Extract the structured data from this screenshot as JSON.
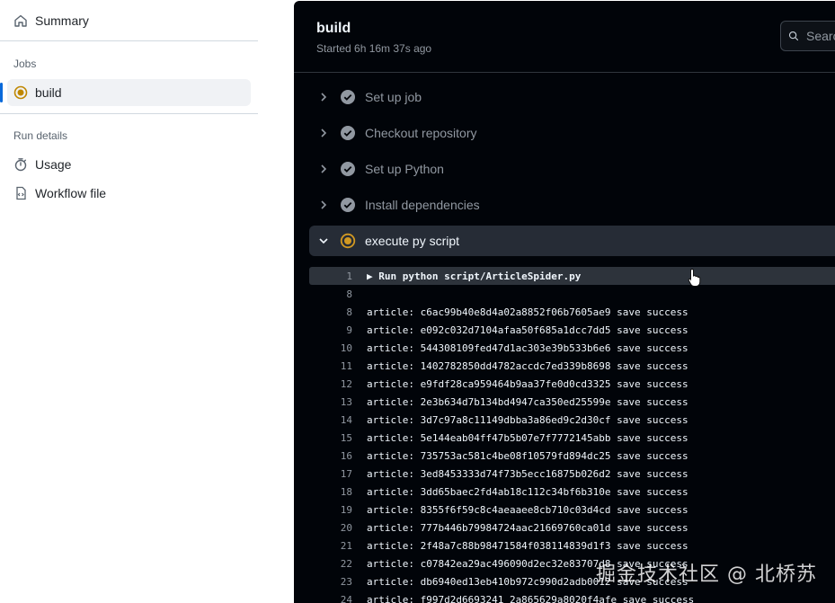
{
  "sidebar": {
    "summary_label": "Summary",
    "jobs_heading": "Jobs",
    "active_job": "build",
    "run_details_heading": "Run details",
    "usage_label": "Usage",
    "workflow_file_label": "Workflow file"
  },
  "job": {
    "title": "build",
    "started": "Started 6h 16m 37s ago"
  },
  "search": {
    "placeholder": "Search logs"
  },
  "steps": [
    {
      "label": "Set up job",
      "status": "success"
    },
    {
      "label": "Checkout repository",
      "status": "success"
    },
    {
      "label": "Set up Python",
      "status": "success"
    },
    {
      "label": "Install dependencies",
      "status": "success"
    },
    {
      "label": "execute py script",
      "status": "in-progress"
    }
  ],
  "log": [
    {
      "num": "1",
      "text": "▶ Run python script/ArticleSpider.py"
    },
    {
      "num": "8",
      "text": ""
    },
    {
      "num": "8",
      "text": "article: c6ac99b40e8d4a02a8852f06b7605ae9 save success"
    },
    {
      "num": "9",
      "text": "article: e092c032d7104afaa50f685a1dcc7dd5 save success"
    },
    {
      "num": "10",
      "text": "article: 544308109fed47d1ac303e39b533b6e6 save success"
    },
    {
      "num": "11",
      "text": "article: 1402782850dd4782accdc7ed339b8698 save success"
    },
    {
      "num": "12",
      "text": "article: e9fdf28ca959464b9aa37fe0d0cd3325 save success"
    },
    {
      "num": "13",
      "text": "article: 2e3b634d7b134bd4947ca350ed25599e save success"
    },
    {
      "num": "14",
      "text": "article: 3d7c97a8c11149dbba3a86ed9c2d30cf save success"
    },
    {
      "num": "15",
      "text": "article: 5e144eab04ff47b5b07e7f7772145abb save success"
    },
    {
      "num": "16",
      "text": "article: 735753ac581c4be08f10579fd894dc25 save success"
    },
    {
      "num": "17",
      "text": "article: 3ed8453333d74f73b5ecc16875b026d2 save success"
    },
    {
      "num": "18",
      "text": "article: 3dd65baec2fd4ab18c112c34bf6b310e save success"
    },
    {
      "num": "19",
      "text": "article: 8355f6f59c8c4aeaaee8cb710c03d4cd save success"
    },
    {
      "num": "20",
      "text": "article: 777b446b79984724aac21669760ca01d save success"
    },
    {
      "num": "21",
      "text": "article: 2f48a7c88b98471584f038114839d1f3 save success"
    },
    {
      "num": "22",
      "text": "article: c07842ea29ac496090d2ec32e83707d8 save success"
    },
    {
      "num": "23",
      "text": "article: db6940ed13eb410b972c990d2adb0012 save success"
    },
    {
      "num": "24",
      "text": "article: f997d2d6693241 2a865629a8020f4afe save success"
    }
  ],
  "watermark": "掘金技术社区 @ 北桥苏",
  "colors": {
    "accent_blue": "#0969da",
    "success_gray": "#9198a1",
    "in_progress_yellow": "#d29922",
    "panel_bg": "#010409"
  }
}
